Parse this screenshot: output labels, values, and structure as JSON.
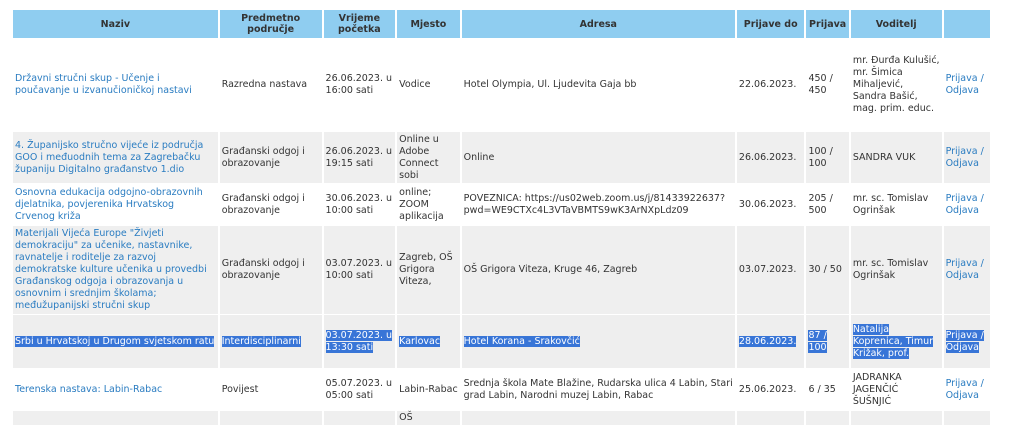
{
  "headers": {
    "naziv": "Naziv",
    "podrucje": "Predmetno područje",
    "vrijeme": "Vrijeme početka",
    "mjesto": "Mjesto",
    "adresa": "Adresa",
    "prijave_do": "Prijave do",
    "prijava": "Prijava",
    "voditelj": "Voditelj",
    "akcija": ""
  },
  "rows": [
    {
      "naziv": "Državni stručni skup - Učenje i poučavanje u izvanučioničkoj nastavi",
      "podrucje": "Razredna nastava",
      "vrijeme": "26.06.2023. u 16:00 sati",
      "mjesto": "Vodice",
      "adresa": "Hotel Olympia, Ul. Ljudevita Gaja bb",
      "prijave_do": "22.06.2023.",
      "prijava": "450 / 450",
      "voditelj": "mr. Đurđa Kulušić, mr. Šimica Mihaljević, Sandra Bašić, mag. prim. educ.",
      "akcija": "Prijava / Odjava"
    },
    {
      "naziv": "4. Županijsko stručno vijeće iz područja GOO i međuodnih tema za Zagrebačku županiju Digitalno građanstvo 1.dio",
      "podrucje": "Građanski odgoj i obrazovanje",
      "vrijeme": "26.06.2023. u 19:15 sati",
      "mjesto": "Online u Adobe Connect sobi",
      "adresa": "Online",
      "prijave_do": "26.06.2023.",
      "prijava": "100 / 100",
      "voditelj": "SANDRA VUK",
      "akcija": "Prijava / Odjava"
    },
    {
      "naziv": "Osnovna edukacija odgojno-obrazovnih djelatnika, povjerenika Hrvatskog Crvenog križa",
      "podrucje": "Građanski odgoj i obrazovanje",
      "vrijeme": "30.06.2023. u 10:00 sati",
      "mjesto": "online; ZOOM aplikacija",
      "adresa": "POVEZNICA: https://us02web.zoom.us/j/81433922637?pwd=WE9CTXc4L3VTaVBMTS9wK3ArNXpLdz09",
      "prijave_do": "30.06.2023.",
      "prijava": "205 / 500",
      "voditelj": "mr. sc. Tomislav Ogrinšak",
      "akcija": "Prijava / Odjava"
    },
    {
      "naziv": "Materijali Vijeća Europe \"Živjeti demokraciju\" za učenike, nastavnike, ravnatelje i roditelje za razvoj demokratske kulture učenika u provedbi Građanskog odgoja i obrazovanja u osnovnim i srednjim školama; međužupanijski stručni skup",
      "podrucje": "Građanski odgoj i obrazovanje",
      "vrijeme": "03.07.2023. u 10:00 sati",
      "mjesto": "Zagreb, OŠ Grigora Viteza,",
      "adresa": "OŠ Grigora Viteza, Kruge 46, Zagreb",
      "prijave_do": "03.07.2023.",
      "prijava": "30 / 50",
      "voditelj": "mr. sc. Tomislav Ogrinšak",
      "akcija": "Prijava / Odjava"
    },
    {
      "naziv": "Srbi u Hrvatskoj u Drugom svjetskom ratu",
      "podrucje": "Interdisciplinarni",
      "vrijeme": "03.07.2023. u 13:30 sati",
      "mjesto": "Karlovac",
      "adresa": "Hotel Korana - Srakovčić",
      "prijave_do": "28.06.2023.",
      "prijava": "87 / 100",
      "voditelj": "Natalija Koprenica, Timur Križak, prof.",
      "akcija": "Prijava / Odjava"
    },
    {
      "naziv": "Terenska nastava: Labin-Rabac",
      "podrucje": "Povijest",
      "vrijeme": "05.07.2023. u 05:00 sati",
      "mjesto": "Labin-Rabac",
      "adresa": "Srednja škola Mate Blažine, Rudarska ulica 4 Labin, Stari grad Labin, Narodni muzej Labin, Rabac",
      "prijave_do": "25.06.2023.",
      "prijava": "6 / 35",
      "voditelj": "JADRANKA JAGENČIĆ ŠUŠNJIĆ",
      "akcija": "Prijava / Odjava"
    }
  ],
  "partial_row": {
    "mjesto": "OŠ"
  },
  "colors": {
    "header_bg": "#8fcdf0",
    "link": "#2a7cc1",
    "selection": "#3875d7",
    "row_alt": "#efefef"
  }
}
